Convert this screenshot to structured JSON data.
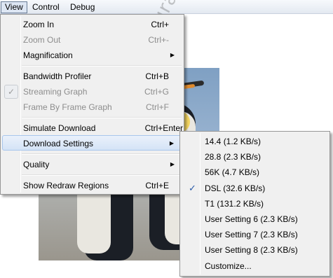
{
  "menubar": {
    "items": [
      {
        "label": "View"
      },
      {
        "label": "Control"
      },
      {
        "label": "Debug"
      }
    ]
  },
  "view_menu": {
    "items": [
      {
        "label": "Zoom In",
        "shortcut": "Ctrl+",
        "state": "enabled"
      },
      {
        "label": "Zoom Out",
        "shortcut": "Ctrl+-",
        "state": "disabled"
      },
      {
        "label": "Magnification",
        "shortcut": "",
        "submenu": true
      },
      {
        "label": "Bandwidth Profiler",
        "shortcut": "Ctrl+B",
        "state": "enabled"
      },
      {
        "label": "Streaming Graph",
        "shortcut": "Ctrl+G",
        "state": "disabled",
        "checked": true
      },
      {
        "label": "Frame By Frame Graph",
        "shortcut": "Ctrl+F",
        "state": "disabled"
      },
      {
        "label": "Simulate Download",
        "shortcut": "Ctrl+Enter",
        "state": "enabled"
      },
      {
        "label": "Download Settings",
        "shortcut": "",
        "submenu": true,
        "highlighted": true
      },
      {
        "label": "Quality",
        "shortcut": "",
        "submenu": true
      },
      {
        "label": "Show Redraw Regions",
        "shortcut": "Ctrl+E",
        "state": "enabled"
      }
    ],
    "check_glyph": "✓",
    "arrow_glyph": "▶"
  },
  "download_settings_menu": {
    "items": [
      {
        "label": "14.4 (1.2 KB/s)"
      },
      {
        "label": "28.8 (2.3 KB/s)"
      },
      {
        "label": "56K (4.7 KB/s)"
      },
      {
        "label": "DSL (32.6 KB/s)",
        "checked": true
      },
      {
        "label": "T1 (131.2 KB/s)"
      },
      {
        "label": "User Setting 6 (2.3 KB/s)"
      },
      {
        "label": "User Setting 7 (2.3 KB/s)"
      },
      {
        "label": "User Setting 8 (2.3 KB/s)"
      },
      {
        "label": "Customize..."
      }
    ],
    "check_glyph": "✓",
    "accent_color": "#2a5ba8"
  },
  "watermark": {
    "text": "www.pcsel-programlama.com"
  }
}
